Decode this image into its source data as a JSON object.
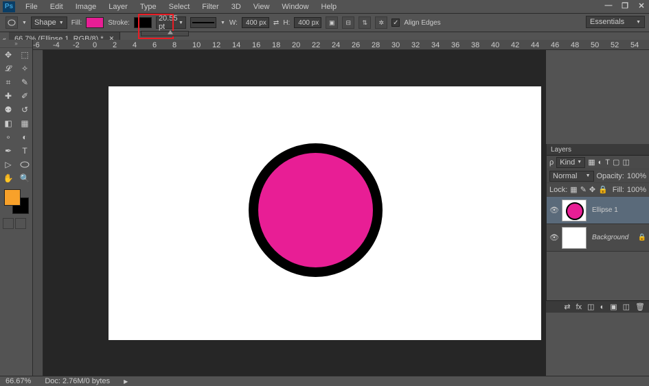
{
  "ps_logo": "Ps",
  "menu": [
    "File",
    "Edit",
    "Image",
    "Layer",
    "Type",
    "Select",
    "Filter",
    "3D",
    "View",
    "Window",
    "Help"
  ],
  "options": {
    "tool_mode": "Shape",
    "fill_label": "Fill:",
    "fill_color": "#e81e95",
    "stroke_label": "Stroke:",
    "stroke_color": "#000000",
    "stroke_width": "20.55 pt",
    "w_label": "W:",
    "w_value": "400 px",
    "h_label": "H:",
    "h_value": "400 px",
    "align_edges": "Align Edges",
    "workspace": "Essentials"
  },
  "document": {
    "tab": "66.7% (Ellipse 1, RGB/8) *"
  },
  "layers_panel": {
    "title": "Layers",
    "kind": "Kind",
    "blend_mode": "Normal",
    "opacity_label": "Opacity:",
    "opacity_value": "100%",
    "lock_label": "Lock:",
    "fill_label": "Fill:",
    "fill_value": "100%",
    "layer1": "Ellipse 1",
    "layer2": "Background"
  },
  "status": {
    "zoom": "66.67%",
    "doc_info": "Doc: 2.76M/0 bytes"
  },
  "ruler_h": [
    -6,
    -4,
    -2,
    0,
    2,
    4,
    6,
    8,
    10,
    12,
    14,
    16,
    18,
    20,
    22,
    24,
    26,
    28,
    30,
    32,
    34,
    36,
    38,
    40,
    42,
    44,
    46,
    48,
    50,
    52,
    54
  ],
  "fg_color": "#f8a12a",
  "bg_color": "#000000",
  "chart_data": null
}
